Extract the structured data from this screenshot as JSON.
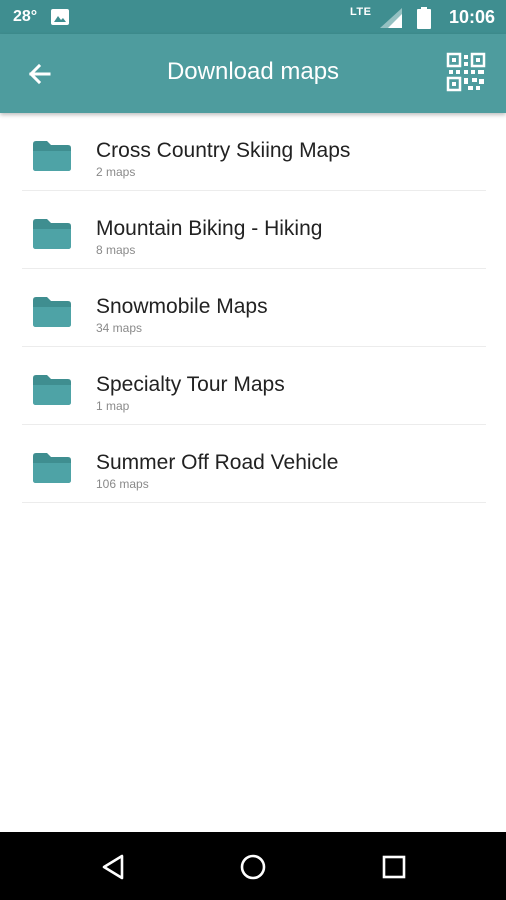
{
  "status_bar": {
    "temperature": "28°",
    "network": "LTE",
    "time": "10:06",
    "icons": [
      "image-icon",
      "signal-icon",
      "battery-icon"
    ]
  },
  "app_bar": {
    "title": "Download maps",
    "icons": [
      "back-arrow-icon",
      "qr-code-icon"
    ],
    "color": "#4e9c9e"
  },
  "folders": [
    {
      "name": "Cross Country Skiing Maps",
      "count": "2 maps"
    },
    {
      "name": "Mountain Biking - Hiking",
      "count": "8 maps"
    },
    {
      "name": "Snowmobile Maps",
      "count": "34 maps"
    },
    {
      "name": "Specialty Tour Maps",
      "count": "1 map"
    },
    {
      "name": "Summer Off Road Vehicle",
      "count": "106 maps"
    }
  ],
  "folder_icon": "folder-icon",
  "folder_color": "#3f8e90",
  "nav_bar": {
    "icons": [
      "back-triangle-icon",
      "home-circle-icon",
      "recents-square-icon"
    ]
  }
}
